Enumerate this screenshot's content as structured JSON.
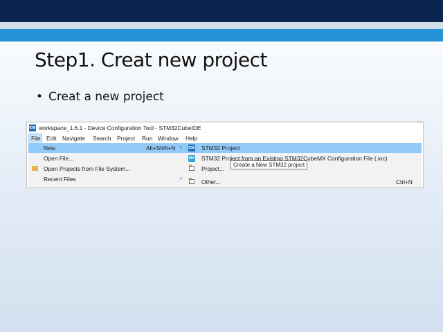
{
  "slide": {
    "title": "Step1. Creat new project",
    "bullet": "Creat a new project"
  },
  "ide": {
    "window_title": "workspace_1.6.1 - Device Configuration Tool - STM32CubeIDE",
    "app_icon": "IDE",
    "menubar": [
      "File",
      "Edit",
      "Navigate",
      "Search",
      "Project",
      "Run",
      "Window",
      "Help"
    ],
    "file_menu": [
      {
        "label": "New",
        "shortcut": "Alt+Shift+N",
        "arrow": "›",
        "icon": "none",
        "active": true
      },
      {
        "label": "Open File...",
        "shortcut": "",
        "arrow": "",
        "icon": "none",
        "active": false
      },
      {
        "label": "Open Projects from File System...",
        "shortcut": "",
        "arrow": "",
        "icon": "folder-icon",
        "active": false
      },
      {
        "label": "Recent Files",
        "shortcut": "",
        "arrow": "›",
        "icon": "none",
        "active": false
      }
    ],
    "new_submenu": [
      {
        "label": "STM32 Project",
        "icon": "IDE",
        "shortcut": "",
        "active": true
      },
      {
        "label": "STM32 Project from an Existing STM32CubeMX Configuration File (.ioc)",
        "icon": "MX",
        "shortcut": "",
        "active": false
      },
      {
        "label": "Project...",
        "icon": "project-icon",
        "shortcut": "",
        "active": false
      },
      {
        "label": "Other...",
        "icon": "project-icon",
        "shortcut": "Ctrl+N",
        "active": false
      }
    ],
    "tooltip": "Create a New STM32 project"
  },
  "colors": {
    "top_band": "#0b2550",
    "accent_strip": "#2592d6",
    "menu_highlight": "#91c9f7",
    "ide_blue": "#1e6fbf"
  }
}
